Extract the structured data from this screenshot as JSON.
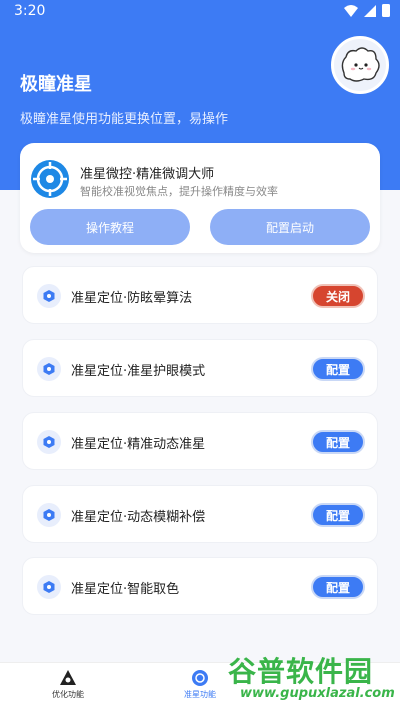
{
  "status_bar": {
    "time": "3:20"
  },
  "header": {
    "title": "极瞳准星",
    "subtitle": "极瞳准星使用功能更换位置，易操作"
  },
  "main_card": {
    "title": "准星微控·精准微调大师",
    "description": "智能校准视觉焦点，提升操作精度与效率",
    "buttons": {
      "tutorial": "操作教程",
      "start": "配置启动"
    }
  },
  "features": [
    {
      "label": "准星定位·防眩晕算法",
      "action": "关闭"
    },
    {
      "label": "准星定位·准星护眼模式",
      "action": "配置"
    },
    {
      "label": "准星定位·精准动态准星",
      "action": "配置"
    },
    {
      "label": "准星定位·动态模糊补偿",
      "action": "配置"
    },
    {
      "label": "准星定位·智能取色",
      "action": "配置"
    }
  ],
  "bottom_nav": {
    "items": [
      {
        "label": "优化功能",
        "icon": "tripod-icon"
      },
      {
        "label": "准星功能",
        "icon": "crosshair-badge-icon",
        "active": true
      }
    ]
  },
  "watermark": {
    "title": "谷普软件园",
    "url": "www.gupuxlazal.com"
  },
  "colors": {
    "primary": "#3d7bf4",
    "danger": "#d6452f",
    "watermark": "#3ab54a"
  }
}
